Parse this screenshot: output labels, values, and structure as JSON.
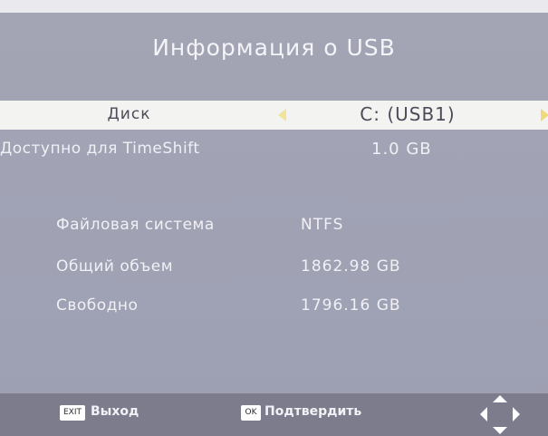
{
  "header": {
    "title": "Информация о USB"
  },
  "disk": {
    "label": "Диск",
    "value": "C: (USB1)"
  },
  "timeshift": {
    "label": "Доступно для TimeShift",
    "value": "1.0 GB"
  },
  "info": {
    "filesystem_label": "Файловая система",
    "filesystem_value": "NTFS",
    "total_label": "Общий объем",
    "total_value": "1862.98 GB",
    "free_label": "Свободно",
    "free_value": "1796.16 GB"
  },
  "footer": {
    "exit_key": "EXIT",
    "exit_label": "Выход",
    "ok_key": "OK",
    "ok_label": "Подтвердить",
    "nav_icon": "navigation-arrows-icon"
  },
  "colors": {
    "background": "#a1a3b5",
    "selected_row": "#f3f3f1",
    "footer": "#7c7c8c",
    "arrow_accent": "#f0d97a"
  }
}
